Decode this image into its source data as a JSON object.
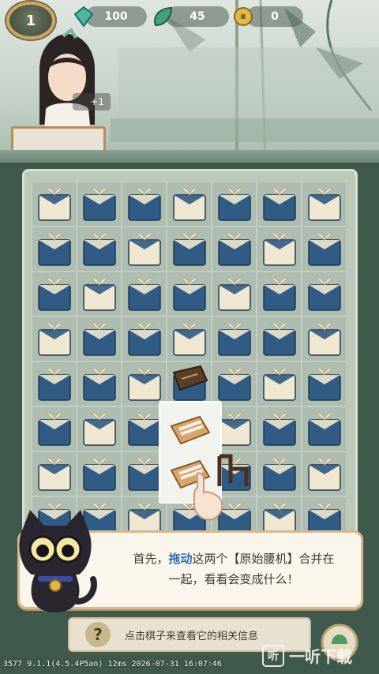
{
  "hud": {
    "level": "1",
    "gems": "100",
    "energy": "45",
    "coins": "0"
  },
  "character": {
    "reward": "+1"
  },
  "board": {
    "rows": 8,
    "cols": 7,
    "item": "gift-box"
  },
  "tutorial": {
    "text_prefix": "首先，",
    "text_highlight": "拖动",
    "text_rest": "这两个【原始腰机】合并在",
    "text_line2": "一起，看看会变成什么！"
  },
  "info": {
    "hint": "点击棋子来查看它的相关信息"
  },
  "footer": {
    "debug": "3577 9.1.1(4.5.4P5an) 12ms 2026-07-31 16:07:46",
    "watermark": "一听下载",
    "watermark_glyph": "听"
  },
  "colors": {
    "gift_blue": "#2f5b84",
    "ribbon_cream": "#efe7cf",
    "highlight_text": "#2d6fb1",
    "dialog_border": "#d7b98f"
  }
}
